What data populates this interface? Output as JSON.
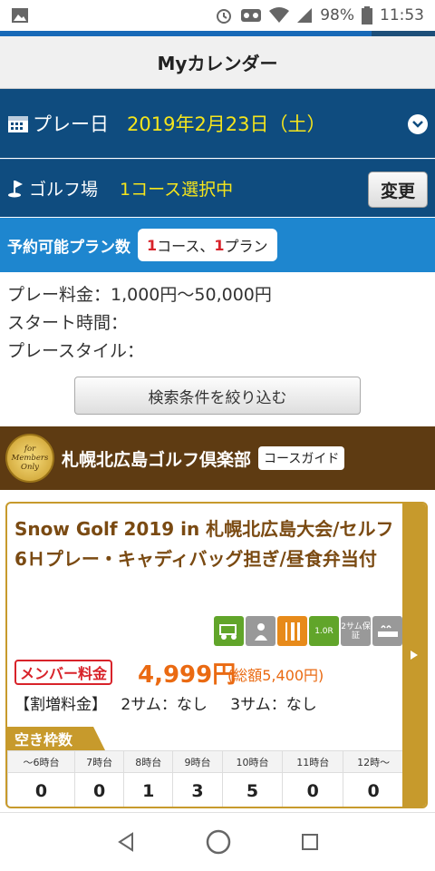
{
  "status": {
    "battery": "98%",
    "time": "11:53"
  },
  "header": {
    "title": "Myカレンダー"
  },
  "play_date": {
    "label": "プレー日",
    "value": "2019年2月23日（土）"
  },
  "golf_course": {
    "label": "ゴルフ場",
    "value": "1コース選択中",
    "change_label": "変更"
  },
  "plans": {
    "label": "予約可能プラン数",
    "course_count": "1",
    "course_suffix": "コース、",
    "plan_count": "1",
    "plan_suffix": "プラン"
  },
  "conditions": {
    "fee": "プレー料金：1,000円〜50,000円",
    "start_time": "スタート時間：",
    "style": "プレースタイル："
  },
  "filter_label": "検索条件を絞り込む",
  "course": {
    "badge_lines": [
      "for",
      "Members",
      "Only"
    ],
    "name": "札幌北広島ゴルフ倶楽部",
    "guide_label": "コースガイド",
    "plan": {
      "title": "Snow Golf 2019 in 札幌北広島大会/セルフ6Ｈプレー・キャディバッグ担ぎ/昼食弁当付",
      "amenities": [
        {
          "icon": "cart-icon",
          "text": ""
        },
        {
          "icon": "caddie-icon",
          "text": ""
        },
        {
          "icon": "meal-icon",
          "text": ""
        },
        {
          "icon": "lesson-icon",
          "text": "1.0R"
        },
        {
          "icon": "pairing-icon",
          "text": "2サム保証"
        },
        {
          "icon": "bath-icon",
          "text": ""
        }
      ],
      "member_label": "メンバー料金",
      "price": "4,999円",
      "price_total": "(総額5,400円)",
      "surcharge_label": "【割増料金】",
      "surcharge_2": "2サム：なし",
      "surcharge_3": "3サム：なし",
      "vacancy_label": "空き枠数",
      "slots": [
        {
          "time": "〜6時台",
          "count": "0"
        },
        {
          "time": "7時台",
          "count": "0"
        },
        {
          "time": "8時台",
          "count": "1"
        },
        {
          "time": "9時台",
          "count": "3"
        },
        {
          "time": "10時台",
          "count": "5"
        },
        {
          "time": "11時台",
          "count": "0"
        },
        {
          "time": "12時〜",
          "count": "0"
        }
      ]
    }
  }
}
